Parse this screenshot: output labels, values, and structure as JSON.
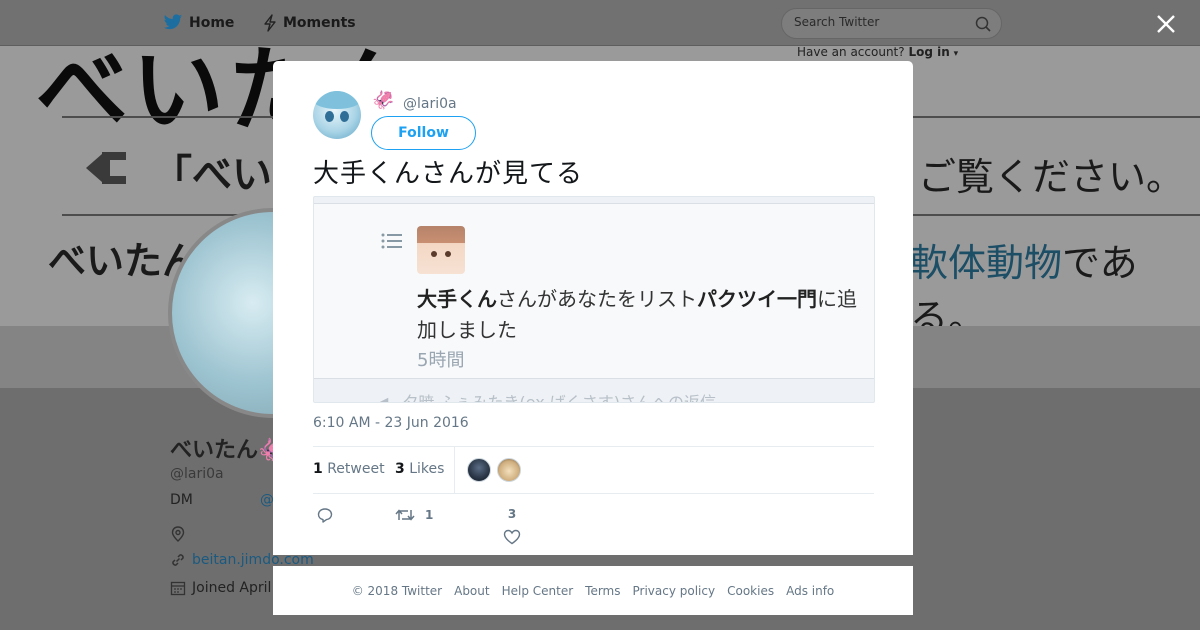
{
  "nav": {
    "home_label": "Home",
    "moments_label": "Moments",
    "search_placeholder": "Search Twitter",
    "have_account": "Have an account?",
    "login_label": "Log in"
  },
  "background_banner": {
    "big_text": "べいたん",
    "row2_left": "「べいた",
    "row2_right": "ご覧ください。",
    "row3_left": "べいたん",
    "row3_right_accent": "軟体動物",
    "row3_right_rest": "である。"
  },
  "background_profile": {
    "name": "べいたん🦑",
    "handle": "@lari0a",
    "dm_label": "DM",
    "dm_link": "@",
    "website": "beitan.jimdo.com",
    "joined": "Joined April"
  },
  "tweet": {
    "header_emoji": "🦑",
    "handle": "@lari0a",
    "follow_label": "Follow",
    "text": "大手くんさんが見てる",
    "media": {
      "notif_name": "大手くん",
      "notif_middle": "さんがあなたをリスト",
      "notif_list": "パクツイ一門",
      "notif_end": "に追加しました",
      "time": "5時間",
      "next_line": "夕暁 ふぇみたき(ex ばくさす)さんへの返信"
    },
    "timestamp": "6:10 AM - 23 Jun 2016",
    "retweets_count": "1",
    "retweets_label": "Retweet",
    "likes_count": "3",
    "likes_label": "Likes",
    "action_retweet_count": "1",
    "action_like_count": "3"
  },
  "footer": {
    "copyright": "© 2018 Twitter",
    "links": [
      "About",
      "Help Center",
      "Terms",
      "Privacy policy",
      "Cookies",
      "Ads info"
    ]
  },
  "colors": {
    "accent": "#1da1f2",
    "muted": "#657786",
    "overlay": "#6e6e6e"
  }
}
